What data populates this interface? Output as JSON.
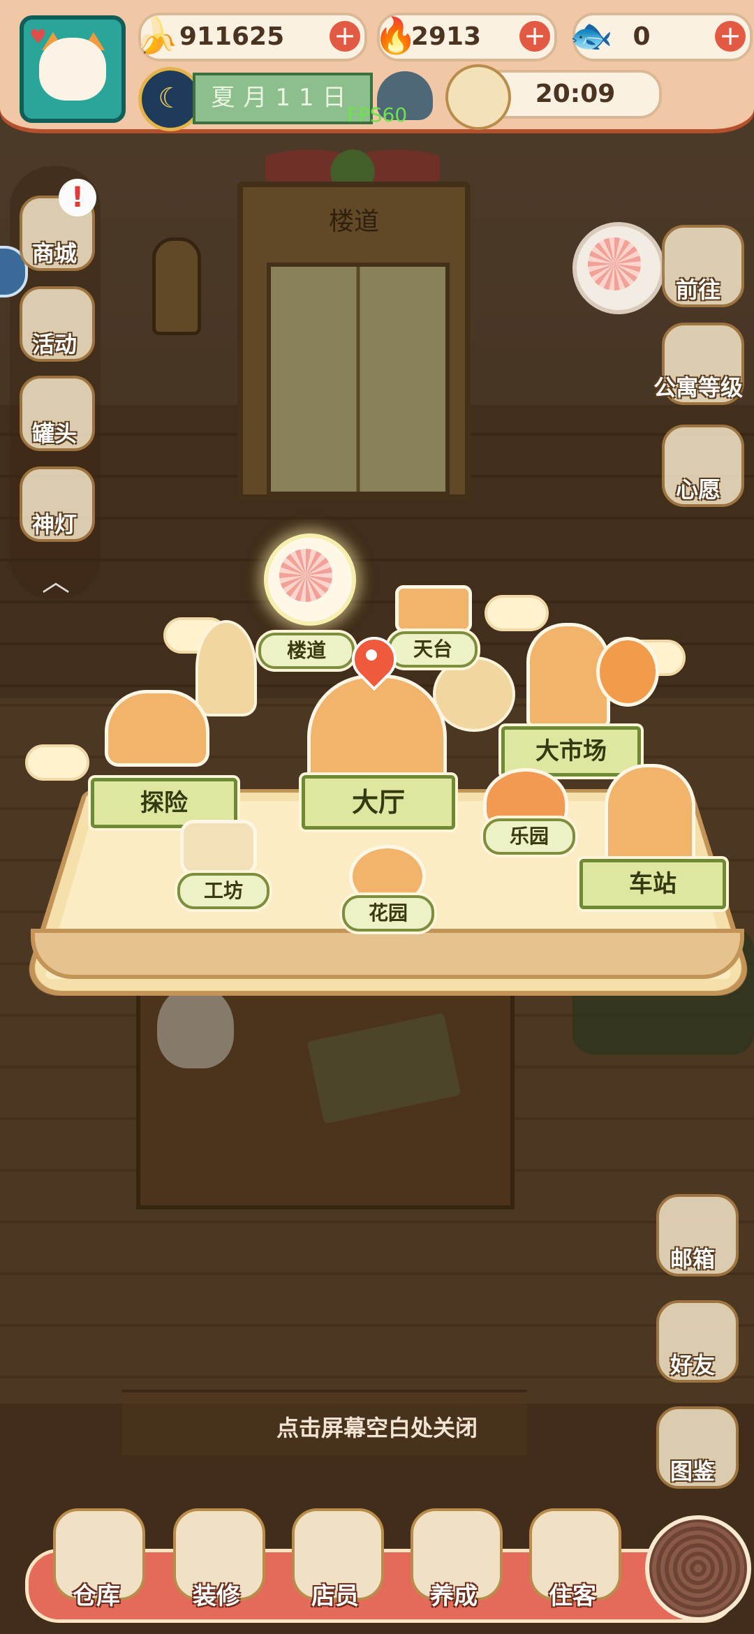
{
  "currencies": {
    "banana": {
      "value": "911625",
      "icon": "banana-icon"
    },
    "flame": {
      "value": "2913",
      "icon": "blue-flame-icon"
    },
    "fish": {
      "value": "0",
      "icon": "fish-icon"
    }
  },
  "status": {
    "date": "夏月11日",
    "time": "20:09",
    "fps": "FPS60"
  },
  "scene": {
    "elevator_sign": "楼道"
  },
  "left_menu": [
    {
      "label": "商城",
      "icon": "shop-icon",
      "alert": "!"
    },
    {
      "label": "活动",
      "icon": "gift-icon"
    },
    {
      "label": "罐头",
      "icon": "can-icon"
    },
    {
      "label": "神灯",
      "icon": "magic-lamp-icon"
    }
  ],
  "right_menu": [
    {
      "label": "前往",
      "icon": "map-pin-icon"
    },
    {
      "label": "公寓等级",
      "icon": "sun-badge-icon"
    },
    {
      "label": "心愿",
      "icon": "heart-book-icon"
    },
    {
      "label": "邮箱",
      "icon": "mailbox-icon"
    },
    {
      "label": "好友",
      "icon": "friends-icon"
    },
    {
      "label": "图鉴",
      "icon": "album-icon"
    }
  ],
  "map": {
    "locations": {
      "corridor": "楼道",
      "rooftop": "天台",
      "market": "大市场",
      "explore": "探险",
      "lobby": "大厅",
      "park": "乐园",
      "workshop": "工坊",
      "garden": "花园",
      "station": "车站"
    }
  },
  "hint": "点击屏幕空白处关闭",
  "dock": [
    {
      "label": "仓库",
      "icon": "warehouse-icon"
    },
    {
      "label": "装修",
      "icon": "paint-brush-icon"
    },
    {
      "label": "店员",
      "icon": "staff-cat-icon"
    },
    {
      "label": "养成",
      "icon": "cultivate-cat-icon"
    },
    {
      "label": "住客",
      "icon": "guest-icon"
    }
  ],
  "colors": {
    "accent": "#e46a5a",
    "ribbon": "#dfe6a0",
    "fps": "#6ee24a"
  }
}
